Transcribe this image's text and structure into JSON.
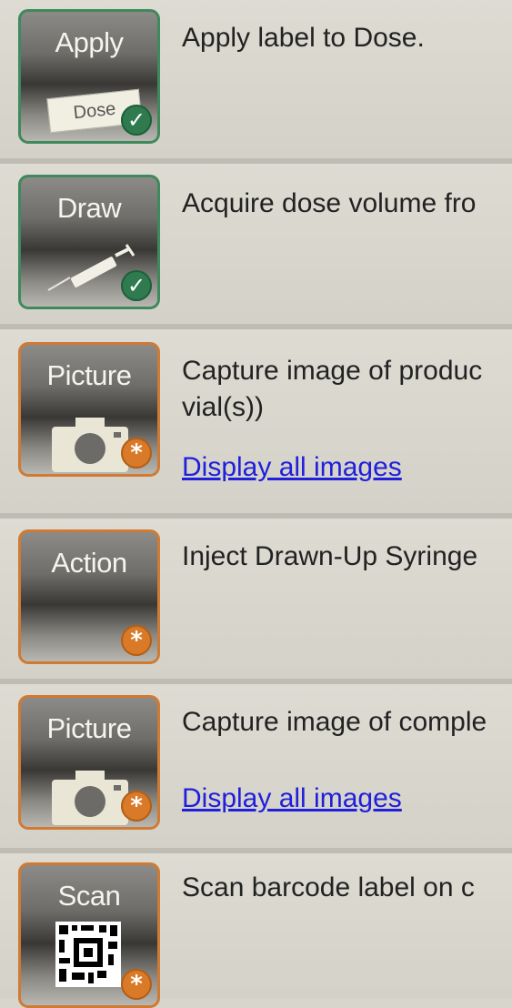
{
  "steps": [
    {
      "button_label": "Apply",
      "button_icon": "dose-label-icon",
      "card_text": "Dose",
      "status": "completed",
      "description": "Apply label to Dose."
    },
    {
      "button_label": "Draw",
      "button_icon": "syringe-icon",
      "status": "completed",
      "description": "Acquire dose volume fro"
    },
    {
      "button_label": "Picture",
      "button_icon": "camera-icon",
      "status": "pending",
      "description_line1": "Capture image of produc",
      "description_line2": "vial(s))",
      "link": "Display all images"
    },
    {
      "button_label": "Action",
      "status": "pending",
      "description": "Inject Drawn-Up Syringe"
    },
    {
      "button_label": "Picture",
      "button_icon": "camera-icon",
      "status": "pending",
      "description": "Capture image of comple",
      "link": "Display all images"
    },
    {
      "button_label": "Scan",
      "button_icon": "barcode-icon",
      "status": "pending",
      "description": "Scan barcode label on c"
    }
  ],
  "colors": {
    "completed_border": "#3f8a5c",
    "pending_border": "#d07a34",
    "link": "#1f1fdc"
  }
}
